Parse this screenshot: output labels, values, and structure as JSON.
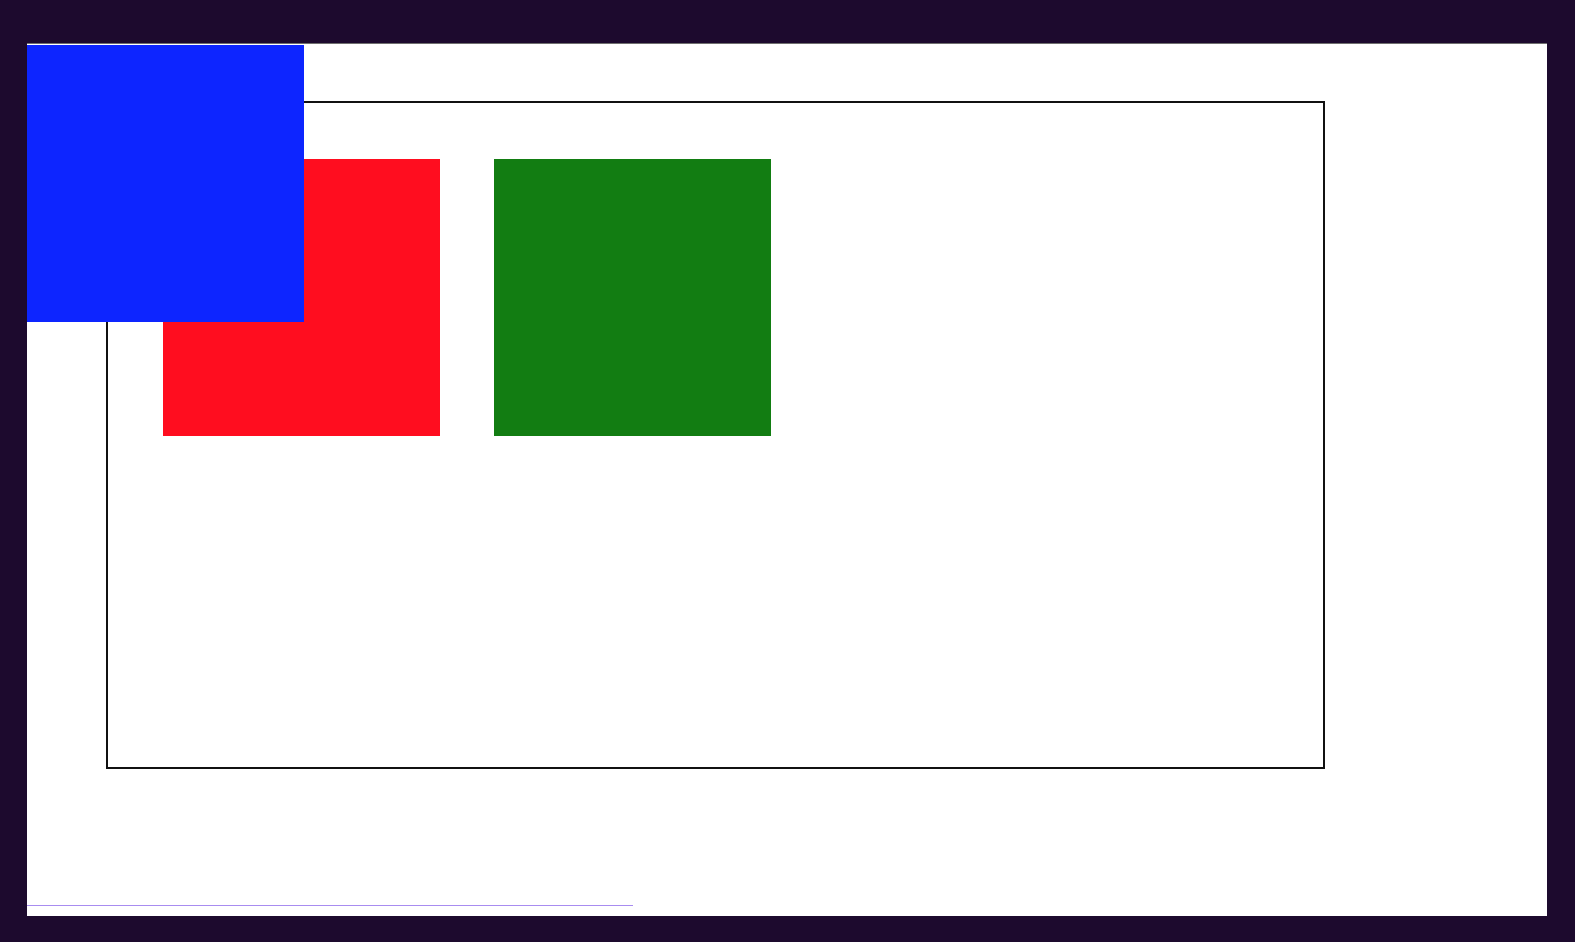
{
  "page": {
    "background_color": "#1d0a2e",
    "viewport_background": "#ffffff"
  },
  "colors": {
    "container_border": "#111111",
    "red_rect": "#ff0d1f",
    "green_rect": "#127d12",
    "blue_rect": "#0d25ff",
    "scroll_indicator": "#a88cf0"
  },
  "shapes": [
    {
      "id": "red",
      "fill": "#ff0d1f"
    },
    {
      "id": "green",
      "fill": "#127d12"
    },
    {
      "id": "blue",
      "fill": "#0d25ff"
    }
  ]
}
